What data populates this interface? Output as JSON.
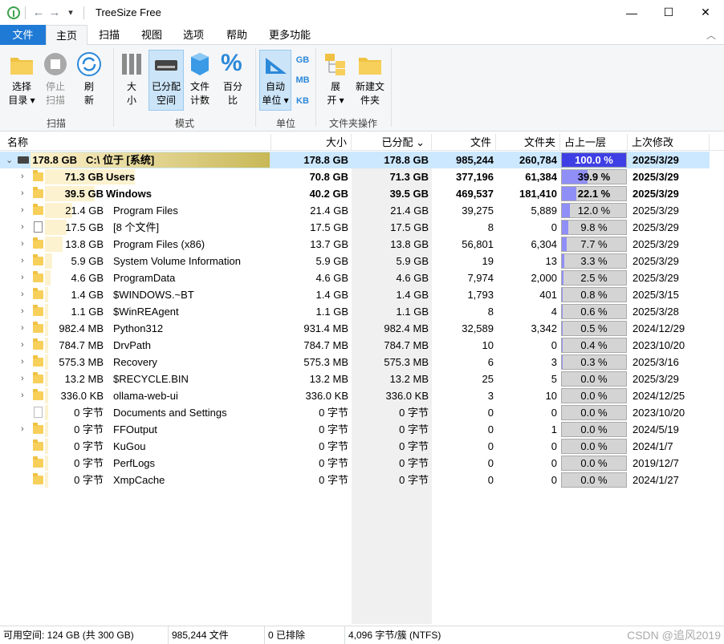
{
  "window": {
    "title": "TreeSize Free",
    "minimize": "—",
    "maximize": "☐",
    "close": "✕"
  },
  "quick_access": {
    "back": "←",
    "forward": "→",
    "dropdown": "▾"
  },
  "tabs": [
    "文件",
    "主页",
    "扫描",
    "视图",
    "选项",
    "帮助",
    "更多功能"
  ],
  "ribbon": {
    "select_dir_1": "选择",
    "select_dir_2": "目录 ▾",
    "stop_1": "停止",
    "stop_2": "扫描",
    "refresh_1": "刷",
    "refresh_2": "新",
    "size_1": "大",
    "size_2": "小",
    "allocated_1": "已分配",
    "allocated_2": "空间",
    "filecount_1": "文件",
    "filecount_2": "计数",
    "percent_1": "百分",
    "percent_2": "比",
    "auto_unit_1": "自动",
    "auto_unit_2": "单位 ▾",
    "gb": "GB",
    "mb": "MB",
    "kb": "KB",
    "expand_1": "展",
    "expand_2": "开 ▾",
    "newfolder_1": "新建文",
    "newfolder_2": "件夹",
    "group_scan": "扫描",
    "group_mode": "模式",
    "group_unit": "单位",
    "group_folder_ops": "文件夹操作",
    "percent_symbol": "%"
  },
  "columns": {
    "name": "名称",
    "size": "大小",
    "allocated": "已分配 ⌄",
    "files": "文件",
    "folders": "文件夹",
    "percent": "占上一层 %...",
    "modified": "上次修改"
  },
  "rows": [
    {
      "expander": "⌄",
      "icon": "drive",
      "sizelabel": "178.8 GB",
      "name": "C:\\  位于 [系统]",
      "size": "178.8 GB",
      "alloc": "178.8 GB",
      "files": "985,244",
      "folders": "260,784",
      "pct_text": "100.0 %",
      "pct": 100.0,
      "modified": "2025/3/29",
      "bold": true,
      "selected": true
    },
    {
      "expander": "›",
      "icon": "folder",
      "sizelabel": "71.3 GB",
      "name": "Users",
      "size": "70.8 GB",
      "alloc": "71.3 GB",
      "files": "377,196",
      "folders": "61,384",
      "pct_text": "39.9 %",
      "pct": 39.9,
      "modified": "2025/3/29",
      "bold": true
    },
    {
      "expander": "›",
      "icon": "folder",
      "sizelabel": "39.5 GB",
      "name": "Windows",
      "size": "40.2 GB",
      "alloc": "39.5 GB",
      "files": "469,537",
      "folders": "181,410",
      "pct_text": "22.1 %",
      "pct": 22.1,
      "modified": "2025/3/29",
      "bold": true
    },
    {
      "expander": "›",
      "icon": "folder",
      "sizelabel": "21.4 GB",
      "name": "Program Files",
      "size": "21.4 GB",
      "alloc": "21.4 GB",
      "files": "39,275",
      "folders": "5,889",
      "pct_text": "12.0 %",
      "pct": 12.0,
      "modified": "2025/3/29"
    },
    {
      "expander": "›",
      "icon": "doc",
      "sizelabel": "17.5 GB",
      "name": "[8 个文件]",
      "size": "17.5 GB",
      "alloc": "17.5 GB",
      "files": "8",
      "folders": "0",
      "pct_text": "9.8 %",
      "pct": 9.8,
      "modified": "2025/3/29"
    },
    {
      "expander": "›",
      "icon": "folder",
      "sizelabel": "13.8 GB",
      "name": "Program Files (x86)",
      "size": "13.7 GB",
      "alloc": "13.8 GB",
      "files": "56,801",
      "folders": "6,304",
      "pct_text": "7.7 %",
      "pct": 7.7,
      "modified": "2025/3/29"
    },
    {
      "expander": "›",
      "icon": "folder",
      "sizelabel": "5.9 GB",
      "name": "System Volume Information",
      "size": "5.9 GB",
      "alloc": "5.9 GB",
      "files": "19",
      "folders": "13",
      "pct_text": "3.3 %",
      "pct": 3.3,
      "modified": "2025/3/29"
    },
    {
      "expander": "›",
      "icon": "folder",
      "sizelabel": "4.6 GB",
      "name": "ProgramData",
      "size": "4.6 GB",
      "alloc": "4.6 GB",
      "files": "7,974",
      "folders": "2,000",
      "pct_text": "2.5 %",
      "pct": 2.5,
      "modified": "2025/3/29"
    },
    {
      "expander": "›",
      "icon": "folder",
      "sizelabel": "1.4 GB",
      "name": "$WINDOWS.~BT",
      "size": "1.4 GB",
      "alloc": "1.4 GB",
      "files": "1,793",
      "folders": "401",
      "pct_text": "0.8 %",
      "pct": 0.8,
      "modified": "2025/3/15"
    },
    {
      "expander": "›",
      "icon": "folder",
      "sizelabel": "1.1 GB",
      "name": "$WinREAgent",
      "size": "1.1 GB",
      "alloc": "1.1 GB",
      "files": "8",
      "folders": "4",
      "pct_text": "0.6 %",
      "pct": 0.6,
      "modified": "2025/3/28"
    },
    {
      "expander": "›",
      "icon": "folder",
      "sizelabel": "982.4 MB",
      "name": "Python312",
      "size": "931.4 MB",
      "alloc": "982.4 MB",
      "files": "32,589",
      "folders": "3,342",
      "pct_text": "0.5 %",
      "pct": 0.5,
      "modified": "2024/12/29"
    },
    {
      "expander": "›",
      "icon": "folder",
      "sizelabel": "784.7 MB",
      "name": "DrvPath",
      "size": "784.7 MB",
      "alloc": "784.7 MB",
      "files": "10",
      "folders": "0",
      "pct_text": "0.4 %",
      "pct": 0.4,
      "modified": "2023/10/20"
    },
    {
      "expander": "›",
      "icon": "folder",
      "sizelabel": "575.3 MB",
      "name": "Recovery",
      "size": "575.3 MB",
      "alloc": "575.3 MB",
      "files": "6",
      "folders": "3",
      "pct_text": "0.3 %",
      "pct": 0.3,
      "modified": "2025/3/16"
    },
    {
      "expander": "›",
      "icon": "folder",
      "sizelabel": "13.2 MB",
      "name": "$RECYCLE.BIN",
      "size": "13.2 MB",
      "alloc": "13.2 MB",
      "files": "25",
      "folders": "5",
      "pct_text": "0.0 %",
      "pct": 0.0,
      "modified": "2025/3/29"
    },
    {
      "expander": "›",
      "icon": "folder",
      "sizelabel": "336.0 KB",
      "name": "ollama-web-ui",
      "size": "336.0 KB",
      "alloc": "336.0 KB",
      "files": "3",
      "folders": "10",
      "pct_text": "0.0 %",
      "pct": 0.0,
      "modified": "2024/12/25"
    },
    {
      "expander": "",
      "icon": "link",
      "sizelabel": "0 字节",
      "name": "Documents and Settings",
      "size": "0 字节",
      "alloc": "0 字节",
      "files": "0",
      "folders": "0",
      "pct_text": "0.0 %",
      "pct": 0.0,
      "modified": "2023/10/20"
    },
    {
      "expander": "›",
      "icon": "folder",
      "sizelabel": "0 字节",
      "name": "FFOutput",
      "size": "0 字节",
      "alloc": "0 字节",
      "files": "0",
      "folders": "1",
      "pct_text": "0.0 %",
      "pct": 0.0,
      "modified": "2024/5/19"
    },
    {
      "expander": "",
      "icon": "folder",
      "sizelabel": "0 字节",
      "name": "KuGou",
      "size": "0 字节",
      "alloc": "0 字节",
      "files": "0",
      "folders": "0",
      "pct_text": "0.0 %",
      "pct": 0.0,
      "modified": "2024/1/7"
    },
    {
      "expander": "",
      "icon": "folder",
      "sizelabel": "0 字节",
      "name": "PerfLogs",
      "size": "0 字节",
      "alloc": "0 字节",
      "files": "0",
      "folders": "0",
      "pct_text": "0.0 %",
      "pct": 0.0,
      "modified": "2019/12/7"
    },
    {
      "expander": "",
      "icon": "folder",
      "sizelabel": "0 字节",
      "name": "XmpCache",
      "size": "0 字节",
      "alloc": "0 字节",
      "files": "0",
      "folders": "0",
      "pct_text": "0.0 %",
      "pct": 0.0,
      "modified": "2024/1/27"
    }
  ],
  "status": {
    "free": "可用空间: 124 GB  (共 300 GB)",
    "files": "985,244 文件",
    "excluded": "0 已排除",
    "cluster": "4,096 字节/簇 (NTFS)",
    "watermark": "CSDN @追风2019"
  },
  "colors": {
    "accent": "#1e7ad4",
    "pct_fill": "#8f8ff7",
    "pct_fill_top": "#3f3fe6",
    "sizebar": "#fdf2cf",
    "sizebar_top": "#c9b857",
    "selected_row": "#cce8ff"
  }
}
